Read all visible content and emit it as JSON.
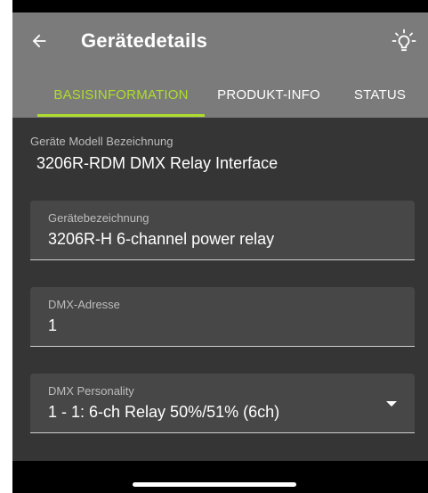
{
  "header": {
    "title": "Gerätedetails",
    "back_icon": "arrow-left-icon",
    "action_icon": "lightbulb-icon"
  },
  "tabs": [
    {
      "label": "BASISINFORMATION",
      "active": true
    },
    {
      "label": "PRODUKT-INFO",
      "active": false
    },
    {
      "label": "STATUS",
      "active": false
    }
  ],
  "content": {
    "model_label": "Geräte Modell Bezeichnung",
    "model_value": "3206R-RDM DMX Relay Interface",
    "fields": [
      {
        "label": "Gerätebezeichnung",
        "value": "3206R-H 6-channel power relay"
      },
      {
        "label": "DMX-Adresse",
        "value": "1"
      },
      {
        "label": "DMX Personality",
        "value": "1 - 1: 6-ch Relay  50%/51% (6ch)"
      }
    ]
  },
  "colors": {
    "accent": "#aedd2c",
    "appbar": "#7b7b7b",
    "background": "#353535",
    "field": "#474747"
  }
}
